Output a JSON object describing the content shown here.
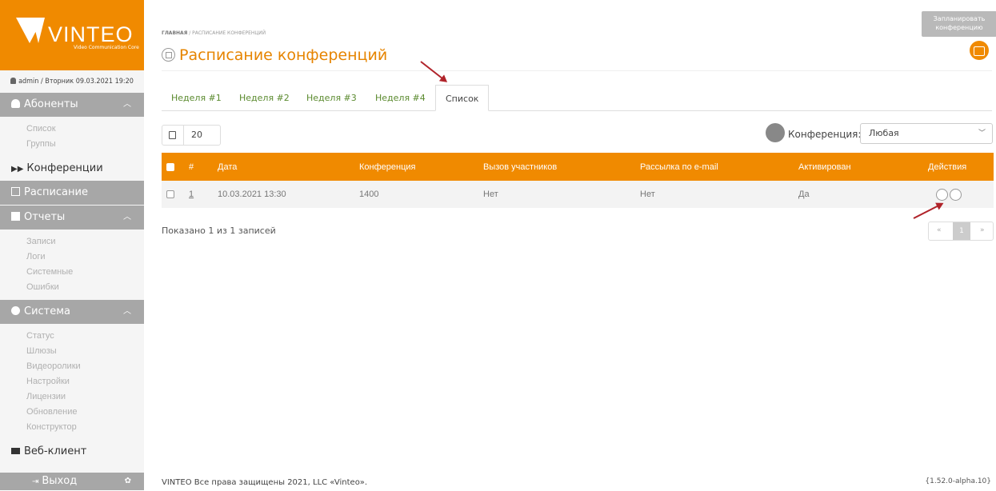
{
  "brand": {
    "name": "VINTEO",
    "tagline": "Video Communication Core",
    "accent": "#f08a00"
  },
  "user": {
    "text": "admin / Вторник 09.03.2021 19:20"
  },
  "sidebar": {
    "subscribers": {
      "label": "Абоненты",
      "items": [
        "Список",
        "Группы"
      ]
    },
    "conferences": {
      "label": "Конференции"
    },
    "schedule": {
      "label": "Расписание"
    },
    "reports": {
      "label": "Отчеты",
      "items": [
        "Записи",
        "Логи",
        "Системные",
        "Ошибки"
      ]
    },
    "system": {
      "label": "Система",
      "items": [
        "Статус",
        "Шлюзы",
        "Видеоролики",
        "Настройки",
        "Лицензии",
        "Обновление",
        "Конструктор"
      ]
    },
    "webclient": {
      "label": "Веб-клиент"
    },
    "logout": {
      "label": "Выход"
    }
  },
  "breadcrumb": {
    "home": "ГЛАВНАЯ",
    "current": " / РАСПИСАНИЕ КОНФЕРЕНЦИЙ"
  },
  "page_title": "Расписание конференций",
  "schedule_button": {
    "label1": "Запланировать",
    "label2": "конференцию"
  },
  "tabs": [
    "Неделя #1",
    "Неделя #2",
    "Неделя #3",
    "Неделя #4",
    "Список"
  ],
  "page_size": "20",
  "filter": {
    "label": "Конференция:",
    "value": "Любая"
  },
  "table": {
    "headers": [
      "#",
      "Дата",
      "Конференция",
      "Вызов участников",
      "Рассылка по e-mail",
      "Активирован",
      "Действия"
    ],
    "rows": [
      {
        "num": "1",
        "date": "10.03.2021 13:30",
        "conference": "1400",
        "call": "Нет",
        "email": "Нет",
        "active": "Да"
      }
    ]
  },
  "info": "Показано 1 из 1 записей",
  "pager": {
    "prev": "«",
    "current": "1",
    "next": "»"
  },
  "footer": "VINTEO   Все права защищены 2021, LLC «Vinteo».",
  "version": "{1.52.0-alpha.10}"
}
